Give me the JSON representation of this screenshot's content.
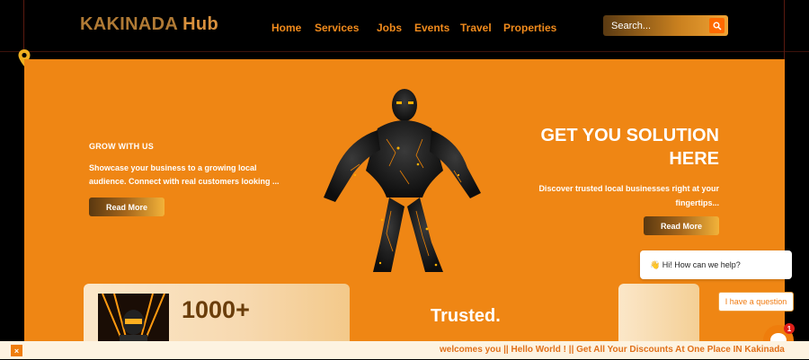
{
  "brand": {
    "part1": "KAKINADA",
    "part2": " Hub"
  },
  "nav": {
    "items": [
      {
        "label": "Home"
      },
      {
        "label": "Services"
      },
      {
        "label": "Jobs"
      },
      {
        "label": "Events"
      },
      {
        "label": "Travel"
      },
      {
        "label": "Properties"
      }
    ]
  },
  "search": {
    "placeholder": "Search..."
  },
  "hero": {
    "eyebrow": "GROW WITH US",
    "lead": "Showcase your business to a growing local audience. Connect with real customers looking ...",
    "left_button": "Read More",
    "right_title_line1": "GET YOU SOLUTION",
    "right_title_line2": "HERE",
    "right_desc": "Discover trusted local businesses right at your fingertips...",
    "right_button": "Read More"
  },
  "stats": {
    "number": "1000+",
    "trusted": "Trusted."
  },
  "chat": {
    "greeting": "👋 Hi! How can we help?",
    "ask": "I have a question",
    "badge": "1"
  },
  "ticker": {
    "close": "×",
    "text": "welcomes you   ||   Hello World !   ||   Get All Your Discounts At One Place IN Kakinada"
  },
  "colors": {
    "accent": "#ef8614",
    "nav": "#f08a1c",
    "dark": "#000000"
  }
}
